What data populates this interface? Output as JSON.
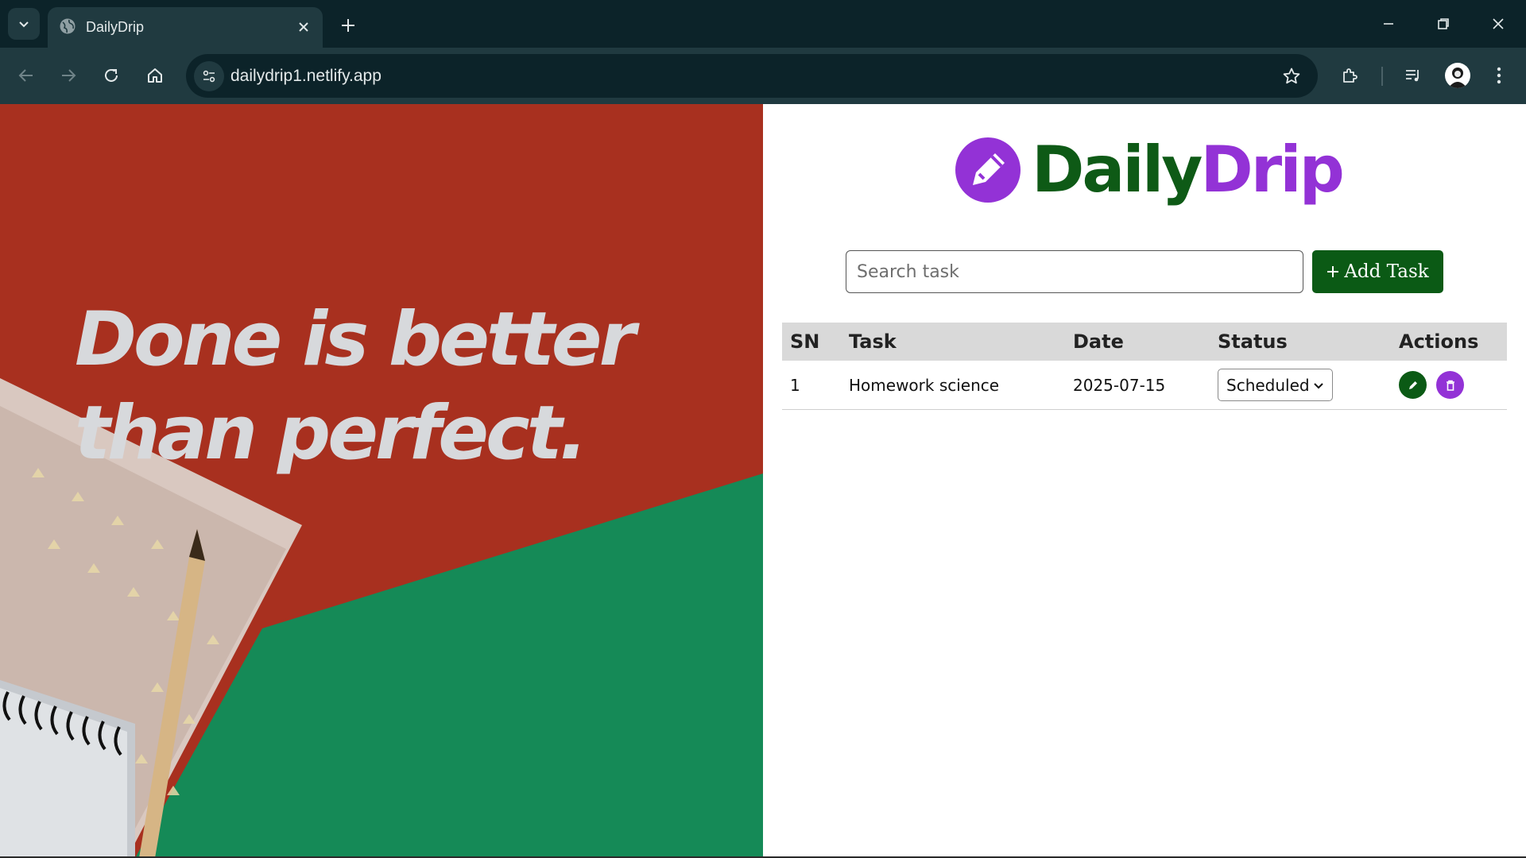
{
  "browser": {
    "tab_title": "DailyDrip",
    "url": "dailydrip1.netlify.app"
  },
  "hero": {
    "quote_line1": "Done is better",
    "quote_line2": "than perfect."
  },
  "app": {
    "brand_part1": "Daily",
    "brand_part2": "Drip",
    "search_placeholder": "Search task",
    "add_button_label": "Add Task",
    "table": {
      "headers": [
        "SN",
        "Task",
        "Date",
        "Status",
        "Actions"
      ],
      "rows": [
        {
          "sn": "1",
          "task": "Homework science",
          "date": "2025-07-15",
          "status": "Scheduled"
        }
      ]
    }
  },
  "colors": {
    "brand_green": "#0b5a15",
    "brand_purple": "#9332d6",
    "chrome_dark": "#0c2329",
    "chrome_toolbar": "#203a40"
  },
  "icons": [
    "tab-search-icon",
    "globe-icon",
    "close-icon",
    "plus-icon",
    "minimize-icon",
    "restore-icon",
    "back-icon",
    "forward-icon",
    "reload-icon",
    "home-icon",
    "site-settings-icon",
    "star-icon",
    "extensions-icon",
    "media-icon",
    "menu-icon",
    "pencil-icon",
    "trash-icon",
    "chevron-down-icon"
  ]
}
